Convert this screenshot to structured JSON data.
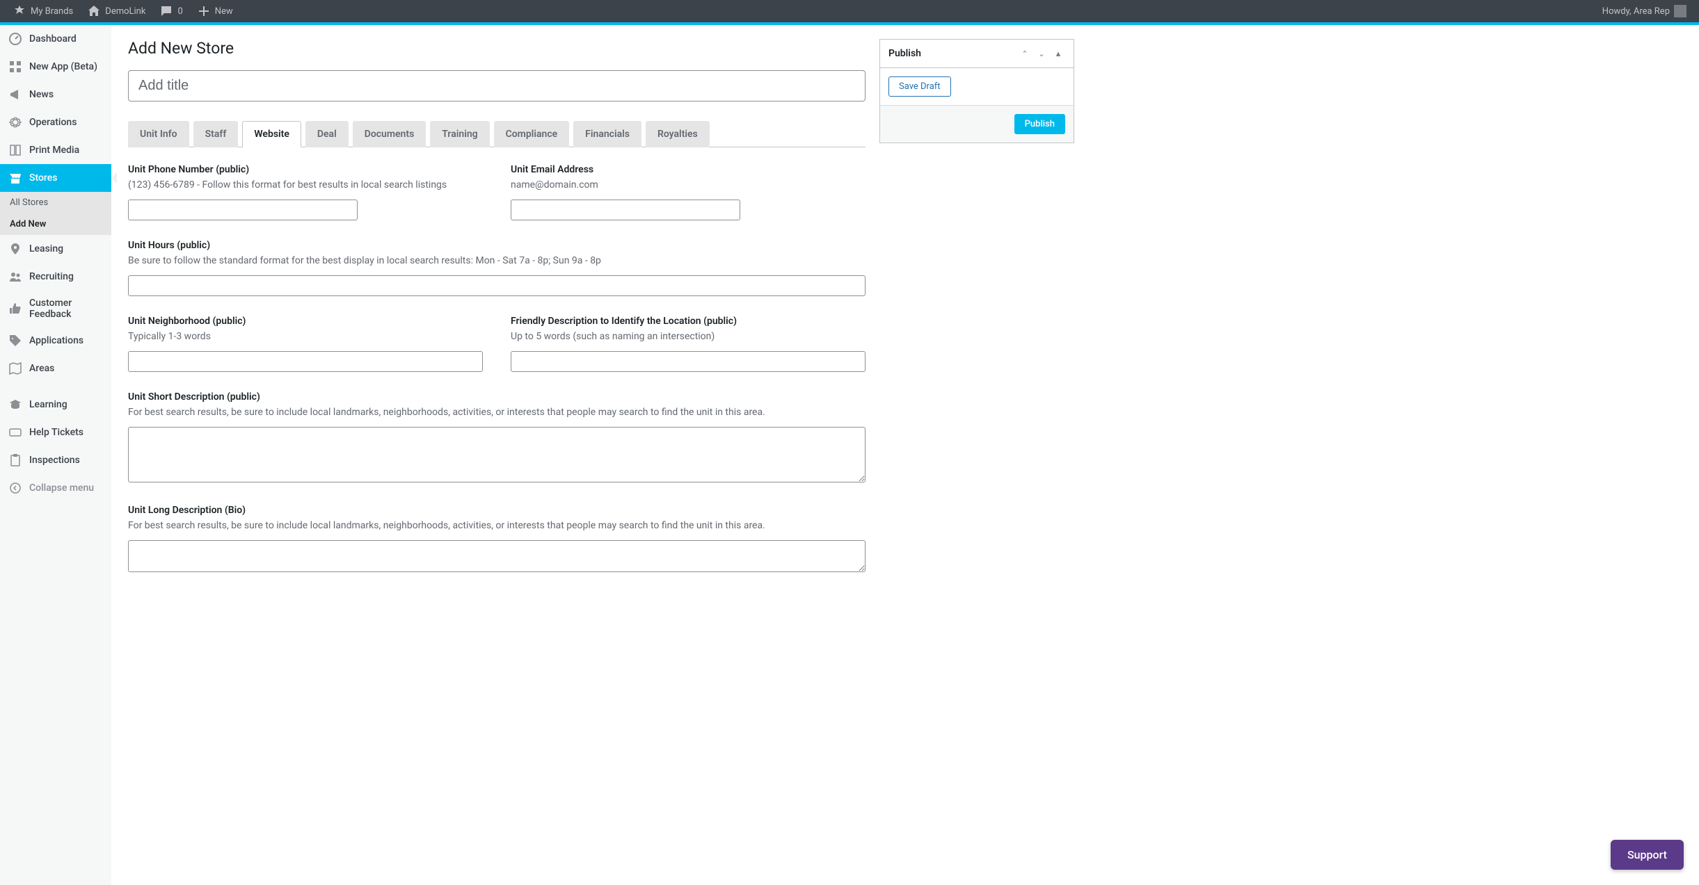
{
  "adminbar": {
    "my_brands": "My Brands",
    "site_name": "DemoLink",
    "comments_count": "0",
    "new_label": "New",
    "greeting": "Howdy, Area Rep"
  },
  "sidebar": {
    "dashboard": "Dashboard",
    "new_app": "New App (Beta)",
    "news": "News",
    "operations": "Operations",
    "print_media": "Print Media",
    "stores": "Stores",
    "all_stores": "All Stores",
    "add_new": "Add New",
    "leasing": "Leasing",
    "recruiting": "Recruiting",
    "customer_feedback": "Customer Feedback",
    "applications": "Applications",
    "areas": "Areas",
    "learning": "Learning",
    "help_tickets": "Help Tickets",
    "inspections": "Inspections",
    "collapse": "Collapse menu"
  },
  "page": {
    "title": "Add New Store",
    "title_placeholder": "Add title"
  },
  "tabs": {
    "unit_info": "Unit Info",
    "staff": "Staff",
    "website": "Website",
    "deal": "Deal",
    "documents": "Documents",
    "training": "Training",
    "compliance": "Compliance",
    "financials": "Financials",
    "royalties": "Royalties"
  },
  "fields": {
    "phone": {
      "label": "Unit Phone Number (public)",
      "hint": "(123) 456-6789 - Follow this format for best results in local search listings"
    },
    "email": {
      "label": "Unit Email Address",
      "hint": "name@domain.com"
    },
    "hours": {
      "label": "Unit Hours (public)",
      "hint": "Be sure to follow the standard format for the best display in local search results: Mon - Sat 7a - 8p; Sun 9a - 8p"
    },
    "neighborhood": {
      "label": "Unit Neighborhood (public)",
      "hint": "Typically 1-3 words"
    },
    "friendly": {
      "label": "Friendly Description to Identify the Location (public)",
      "hint": "Up to 5 words (such as naming an intersection)"
    },
    "short_desc": {
      "label": "Unit Short Description (public)",
      "hint": "For best search results, be sure to include local landmarks, neighborhoods, activities, or interests that people may search to find the unit in this area."
    },
    "long_desc": {
      "label": "Unit Long Description (Bio)",
      "hint": "For best search results, be sure to include local landmarks, neighborhoods, activities, or interests that people may search to find the unit in this area."
    }
  },
  "publish": {
    "title": "Publish",
    "save_draft": "Save Draft",
    "publish_btn": "Publish"
  },
  "support": {
    "label": "Support"
  }
}
